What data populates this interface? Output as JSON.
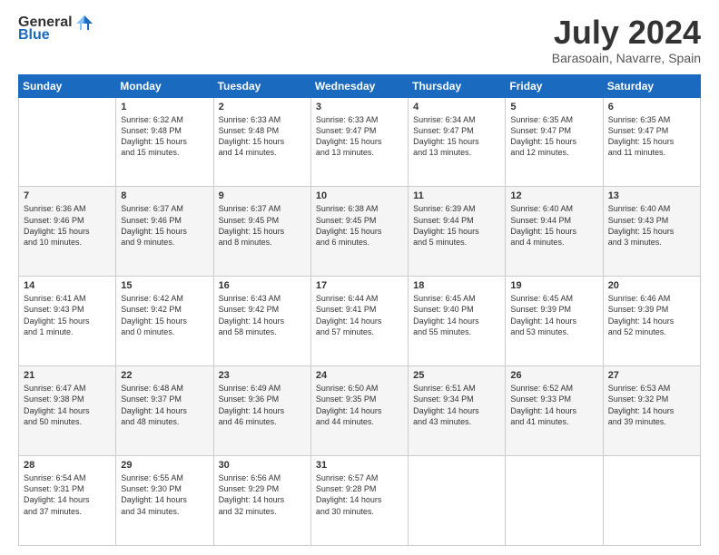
{
  "header": {
    "logo_line1": "General",
    "logo_line2": "Blue",
    "main_title": "July 2024",
    "sub_title": "Barasoain, Navarre, Spain"
  },
  "calendar": {
    "days_of_week": [
      "Sunday",
      "Monday",
      "Tuesday",
      "Wednesday",
      "Thursday",
      "Friday",
      "Saturday"
    ],
    "weeks": [
      [
        {
          "day": "",
          "info": ""
        },
        {
          "day": "1",
          "info": "Sunrise: 6:32 AM\nSunset: 9:48 PM\nDaylight: 15 hours\nand 15 minutes."
        },
        {
          "day": "2",
          "info": "Sunrise: 6:33 AM\nSunset: 9:48 PM\nDaylight: 15 hours\nand 14 minutes."
        },
        {
          "day": "3",
          "info": "Sunrise: 6:33 AM\nSunset: 9:47 PM\nDaylight: 15 hours\nand 13 minutes."
        },
        {
          "day": "4",
          "info": "Sunrise: 6:34 AM\nSunset: 9:47 PM\nDaylight: 15 hours\nand 13 minutes."
        },
        {
          "day": "5",
          "info": "Sunrise: 6:35 AM\nSunset: 9:47 PM\nDaylight: 15 hours\nand 12 minutes."
        },
        {
          "day": "6",
          "info": "Sunrise: 6:35 AM\nSunset: 9:47 PM\nDaylight: 15 hours\nand 11 minutes."
        }
      ],
      [
        {
          "day": "7",
          "info": "Sunrise: 6:36 AM\nSunset: 9:46 PM\nDaylight: 15 hours\nand 10 minutes."
        },
        {
          "day": "8",
          "info": "Sunrise: 6:37 AM\nSunset: 9:46 PM\nDaylight: 15 hours\nand 9 minutes."
        },
        {
          "day": "9",
          "info": "Sunrise: 6:37 AM\nSunset: 9:45 PM\nDaylight: 15 hours\nand 8 minutes."
        },
        {
          "day": "10",
          "info": "Sunrise: 6:38 AM\nSunset: 9:45 PM\nDaylight: 15 hours\nand 6 minutes."
        },
        {
          "day": "11",
          "info": "Sunrise: 6:39 AM\nSunset: 9:44 PM\nDaylight: 15 hours\nand 5 minutes."
        },
        {
          "day": "12",
          "info": "Sunrise: 6:40 AM\nSunset: 9:44 PM\nDaylight: 15 hours\nand 4 minutes."
        },
        {
          "day": "13",
          "info": "Sunrise: 6:40 AM\nSunset: 9:43 PM\nDaylight: 15 hours\nand 3 minutes."
        }
      ],
      [
        {
          "day": "14",
          "info": "Sunrise: 6:41 AM\nSunset: 9:43 PM\nDaylight: 15 hours\nand 1 minute."
        },
        {
          "day": "15",
          "info": "Sunrise: 6:42 AM\nSunset: 9:42 PM\nDaylight: 15 hours\nand 0 minutes."
        },
        {
          "day": "16",
          "info": "Sunrise: 6:43 AM\nSunset: 9:42 PM\nDaylight: 14 hours\nand 58 minutes."
        },
        {
          "day": "17",
          "info": "Sunrise: 6:44 AM\nSunset: 9:41 PM\nDaylight: 14 hours\nand 57 minutes."
        },
        {
          "day": "18",
          "info": "Sunrise: 6:45 AM\nSunset: 9:40 PM\nDaylight: 14 hours\nand 55 minutes."
        },
        {
          "day": "19",
          "info": "Sunrise: 6:45 AM\nSunset: 9:39 PM\nDaylight: 14 hours\nand 53 minutes."
        },
        {
          "day": "20",
          "info": "Sunrise: 6:46 AM\nSunset: 9:39 PM\nDaylight: 14 hours\nand 52 minutes."
        }
      ],
      [
        {
          "day": "21",
          "info": "Sunrise: 6:47 AM\nSunset: 9:38 PM\nDaylight: 14 hours\nand 50 minutes."
        },
        {
          "day": "22",
          "info": "Sunrise: 6:48 AM\nSunset: 9:37 PM\nDaylight: 14 hours\nand 48 minutes."
        },
        {
          "day": "23",
          "info": "Sunrise: 6:49 AM\nSunset: 9:36 PM\nDaylight: 14 hours\nand 46 minutes."
        },
        {
          "day": "24",
          "info": "Sunrise: 6:50 AM\nSunset: 9:35 PM\nDaylight: 14 hours\nand 44 minutes."
        },
        {
          "day": "25",
          "info": "Sunrise: 6:51 AM\nSunset: 9:34 PM\nDaylight: 14 hours\nand 43 minutes."
        },
        {
          "day": "26",
          "info": "Sunrise: 6:52 AM\nSunset: 9:33 PM\nDaylight: 14 hours\nand 41 minutes."
        },
        {
          "day": "27",
          "info": "Sunrise: 6:53 AM\nSunset: 9:32 PM\nDaylight: 14 hours\nand 39 minutes."
        }
      ],
      [
        {
          "day": "28",
          "info": "Sunrise: 6:54 AM\nSunset: 9:31 PM\nDaylight: 14 hours\nand 37 minutes."
        },
        {
          "day": "29",
          "info": "Sunrise: 6:55 AM\nSunset: 9:30 PM\nDaylight: 14 hours\nand 34 minutes."
        },
        {
          "day": "30",
          "info": "Sunrise: 6:56 AM\nSunset: 9:29 PM\nDaylight: 14 hours\nand 32 minutes."
        },
        {
          "day": "31",
          "info": "Sunrise: 6:57 AM\nSunset: 9:28 PM\nDaylight: 14 hours\nand 30 minutes."
        },
        {
          "day": "",
          "info": ""
        },
        {
          "day": "",
          "info": ""
        },
        {
          "day": "",
          "info": ""
        }
      ]
    ]
  }
}
